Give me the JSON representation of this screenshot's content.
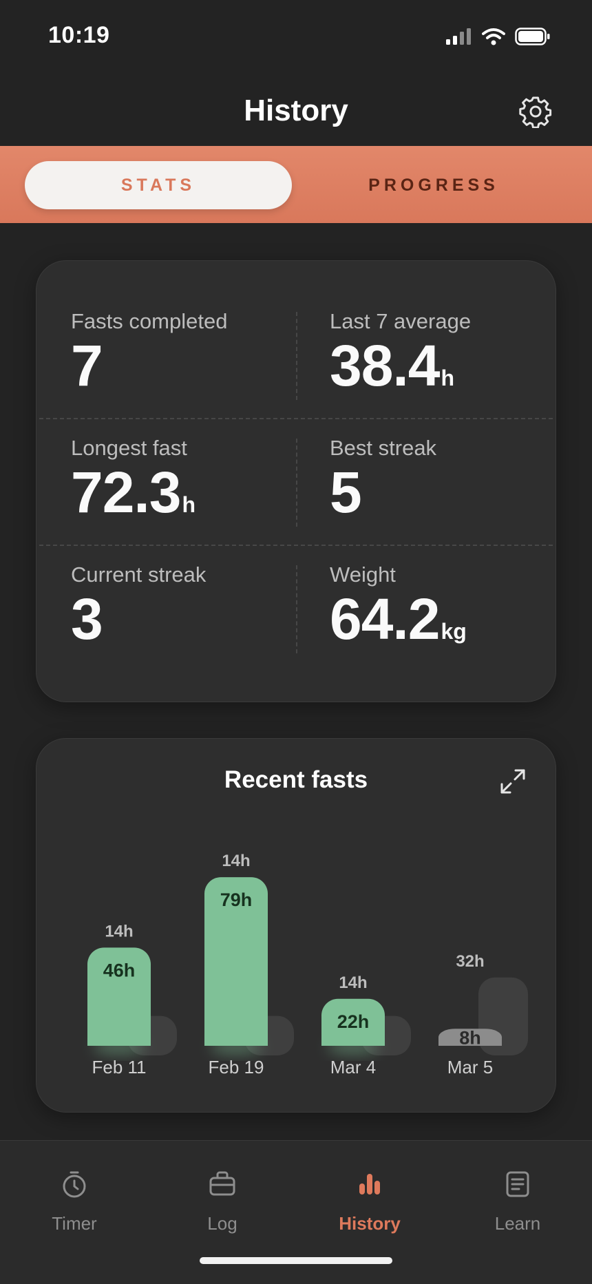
{
  "status_bar": {
    "time": "10:19"
  },
  "header": {
    "title": "History"
  },
  "segments": {
    "stats": "STATS",
    "progress": "PROGRESS",
    "active": "stats"
  },
  "stats": {
    "fasts_completed": {
      "label": "Fasts completed",
      "value": "7",
      "unit": ""
    },
    "last7_average": {
      "label": "Last 7 average",
      "value": "38.4",
      "unit": "h"
    },
    "longest_fast": {
      "label": "Longest fast",
      "value": "72.3",
      "unit": "h"
    },
    "best_streak": {
      "label": "Best streak",
      "value": "5",
      "unit": ""
    },
    "current_streak": {
      "label": "Current streak",
      "value": "3",
      "unit": ""
    },
    "weight": {
      "label": "Weight",
      "value": "64.2",
      "unit": "kg"
    }
  },
  "recent": {
    "title": "Recent fasts"
  },
  "chart_data": {
    "type": "bar",
    "title": "Recent fasts",
    "categories": [
      "Feb 11",
      "Feb 19",
      "Mar 4",
      "Mar 5"
    ],
    "series": [
      {
        "values": [
          46,
          79,
          22,
          8
        ],
        "labels": [
          "46h",
          "79h",
          "22h",
          "8h"
        ]
      },
      {
        "values": [
          14,
          14,
          14,
          32
        ],
        "labels": [
          "14h",
          "14h",
          "14h",
          "32h"
        ]
      }
    ],
    "completed": [
      true,
      true,
      true,
      false
    ],
    "colors": {
      "completed": "#7fc197",
      "incomplete": "#8c8c8c",
      "goal": "#3f3f3f",
      "completed_text": "#17321f",
      "incomplete_text": "#2a2a2a"
    }
  },
  "tabs": [
    {
      "label": "Timer",
      "icon": "timer-icon"
    },
    {
      "label": "Log",
      "icon": "briefcase-icon"
    },
    {
      "label": "History",
      "icon": "bar-chart-icon"
    },
    {
      "label": "Learn",
      "icon": "document-icon"
    }
  ],
  "colors": {
    "accent": "#de7a5c",
    "background": "#232323",
    "card": "#2e2e2e"
  }
}
